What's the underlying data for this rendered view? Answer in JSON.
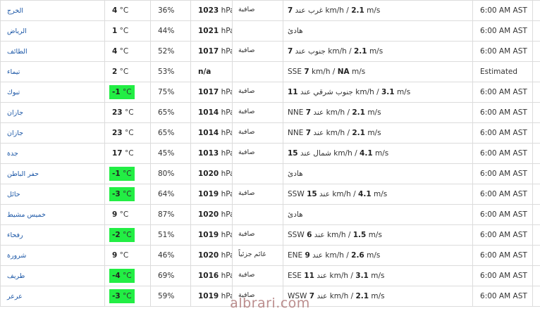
{
  "watermark": "albrari.com",
  "colors": {
    "cold_highlight": "#22ee44",
    "city_link": "#1a56a6"
  },
  "rows": [
    {
      "city": "الخرج",
      "temp": "4",
      "unit": "°C",
      "cold": false,
      "humidity": "36%",
      "pressure": "1023",
      "pressure_unit": "hPa",
      "condition": "صافية",
      "wind_dir": "غرب عند",
      "wind_speed": "7",
      "wind_unit": "km/h /",
      "wind_ms": "2.1",
      "wind_ms_unit": "m/s",
      "time": "6:00 AM AST"
    },
    {
      "city": "الرياض",
      "temp": "1",
      "unit": "°C",
      "cold": false,
      "humidity": "44%",
      "pressure": "1021",
      "pressure_unit": "hPa",
      "condition": "",
      "wind_dir": "هادئ",
      "wind_speed": "",
      "wind_unit": "",
      "wind_ms": "",
      "wind_ms_unit": "",
      "time": "6:00 AM AST"
    },
    {
      "city": "الطائف",
      "temp": "4",
      "unit": "°C",
      "cold": false,
      "humidity": "52%",
      "pressure": "1017",
      "pressure_unit": "hPa",
      "condition": "صافية",
      "wind_dir": "جنوب عند",
      "wind_speed": "7",
      "wind_unit": "km/h /",
      "wind_ms": "2.1",
      "wind_ms_unit": "m/s",
      "time": "6:00 AM AST"
    },
    {
      "city": "تيماء",
      "temp": "2",
      "unit": "°C",
      "cold": false,
      "humidity": "53%",
      "pressure": "n/a",
      "pressure_unit": "",
      "condition": "",
      "wind_dir": "SSE",
      "wind_speed": "7",
      "wind_unit": "km/h /",
      "wind_ms": "NA",
      "wind_ms_unit": "m/s",
      "time": "Estimated"
    },
    {
      "city": "تبوك",
      "temp": "-1",
      "unit": "°C",
      "cold": true,
      "humidity": "75%",
      "pressure": "1017",
      "pressure_unit": "hPa",
      "condition": "صافية",
      "wind_dir": "جنوب شرقي عند",
      "wind_speed": "11",
      "wind_unit": "km/h /",
      "wind_ms": "3.1",
      "wind_ms_unit": "m/s",
      "time": "6:00 AM AST"
    },
    {
      "city": "جازان",
      "temp": "23",
      "unit": "°C",
      "cold": false,
      "humidity": "65%",
      "pressure": "1014",
      "pressure_unit": "hPa",
      "condition": "صافية",
      "wind_dir": "NNE",
      "wind_speed": "7",
      "wind_unit": "عند km/h /",
      "wind_ms": "2.1",
      "wind_ms_unit": "m/s",
      "time": "6:00 AM AST"
    },
    {
      "city": "جازان",
      "temp": "23",
      "unit": "°C",
      "cold": false,
      "humidity": "65%",
      "pressure": "1014",
      "pressure_unit": "hPa",
      "condition": "صافية",
      "wind_dir": "NNE",
      "wind_speed": "7",
      "wind_unit": "عند km/h /",
      "wind_ms": "2.1",
      "wind_ms_unit": "m/s",
      "time": "6:00 AM AST"
    },
    {
      "city": "جدة",
      "temp": "17",
      "unit": "°C",
      "cold": false,
      "humidity": "45%",
      "pressure": "1013",
      "pressure_unit": "hPa",
      "condition": "صافية",
      "wind_dir": "شمال عند",
      "wind_speed": "15",
      "wind_unit": "km/h /",
      "wind_ms": "4.1",
      "wind_ms_unit": "m/s",
      "time": "6:00 AM AST"
    },
    {
      "city": "حفر الباطن",
      "temp": "-1",
      "unit": "°C",
      "cold": true,
      "humidity": "80%",
      "pressure": "1020",
      "pressure_unit": "hPa",
      "condition": "",
      "wind_dir": "هادئ",
      "wind_speed": "",
      "wind_unit": "",
      "wind_ms": "",
      "wind_ms_unit": "",
      "time": "6:00 AM AST"
    },
    {
      "city": "حائل",
      "temp": "-3",
      "unit": "°C",
      "cold": true,
      "humidity": "64%",
      "pressure": "1019",
      "pressure_unit": "hPa",
      "condition": "صافية",
      "wind_dir": "SSW",
      "wind_speed": "15",
      "wind_unit": "عند km/h /",
      "wind_ms": "4.1",
      "wind_ms_unit": "m/s",
      "time": "6:00 AM AST"
    },
    {
      "city": "خميس مشيط",
      "temp": "9",
      "unit": "°C",
      "cold": false,
      "humidity": "87%",
      "pressure": "1020",
      "pressure_unit": "hPa",
      "condition": "",
      "wind_dir": "هادئ",
      "wind_speed": "",
      "wind_unit": "",
      "wind_ms": "",
      "wind_ms_unit": "",
      "time": "6:00 AM AST"
    },
    {
      "city": "رفحاء",
      "temp": "-2",
      "unit": "°C",
      "cold": true,
      "humidity": "51%",
      "pressure": "1019",
      "pressure_unit": "hPa",
      "condition": "صافية",
      "wind_dir": "SSW",
      "wind_speed": "6",
      "wind_unit": "عند km/h /",
      "wind_ms": "1.5",
      "wind_ms_unit": "m/s",
      "time": "6:00 AM AST"
    },
    {
      "city": "شرورة",
      "temp": "9",
      "unit": "°C",
      "cold": false,
      "humidity": "46%",
      "pressure": "1020",
      "pressure_unit": "hPa",
      "condition": "غائم جزئياً",
      "wind_dir": "ENE",
      "wind_speed": "9",
      "wind_unit": "عند km/h /",
      "wind_ms": "2.6",
      "wind_ms_unit": "m/s",
      "time": "6:00 AM AST"
    },
    {
      "city": "طريف",
      "temp": "-4",
      "unit": "°C",
      "cold": true,
      "humidity": "69%",
      "pressure": "1016",
      "pressure_unit": "hPa",
      "condition": "صافية",
      "wind_dir": "ESE",
      "wind_speed": "11",
      "wind_unit": "عند km/h /",
      "wind_ms": "3.1",
      "wind_ms_unit": "m/s",
      "time": "6:00 AM AST"
    },
    {
      "city": "عرعر",
      "temp": "-3",
      "unit": "°C",
      "cold": true,
      "humidity": "59%",
      "pressure": "1019",
      "pressure_unit": "hPa",
      "condition": "صافية",
      "wind_dir": "WSW",
      "wind_speed": "7",
      "wind_unit": "عند km/h /",
      "wind_ms": "2.1",
      "wind_ms_unit": "m/s",
      "time": "6:00 AM AST"
    }
  ]
}
